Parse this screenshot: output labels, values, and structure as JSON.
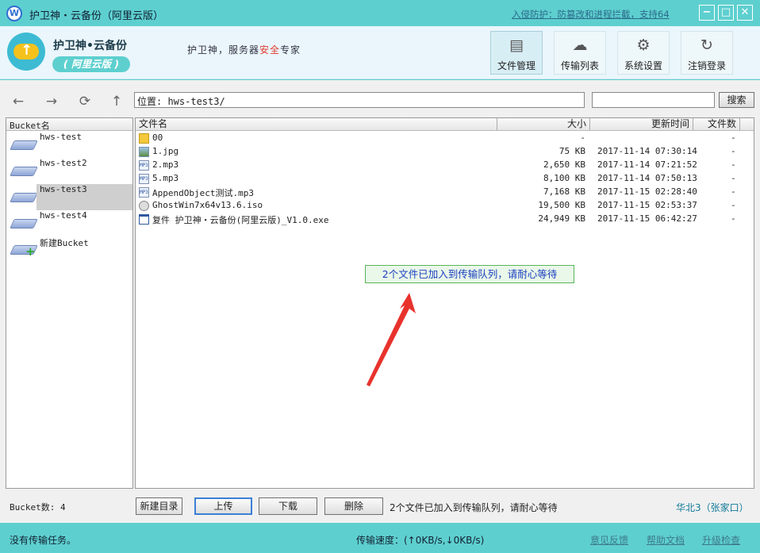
{
  "window": {
    "title": "护卫神・云备份（阿里云版）",
    "notice_link": "入侵防护：防篡改和进程拦截，支持64",
    "btn_min": "−",
    "btn_max": "□",
    "btn_close": "✕",
    "icon_letter": "W"
  },
  "header": {
    "app_name": "护卫神•云备份",
    "app_edition": "( 阿里云版 )",
    "slogan_pre": "护卫神，服务器",
    "slogan_red": "安全",
    "slogan_post": "专家",
    "nav": [
      {
        "label": "文件管理",
        "icon": "file-icon",
        "glyph": "▤"
      },
      {
        "label": "传输列表",
        "icon": "cloud-upload-icon",
        "glyph": "☁"
      },
      {
        "label": "系统设置",
        "icon": "gear-icon",
        "glyph": "⚙"
      },
      {
        "label": "注销登录",
        "icon": "logout-icon",
        "glyph": "↻"
      }
    ]
  },
  "toolbar": {
    "back": "←",
    "forward": "→",
    "refresh": "⟳",
    "up": "↑",
    "path_value": "位置: hws-test3/",
    "search_value": "",
    "search_label": "搜索"
  },
  "buckets": {
    "header": "Bucket名",
    "items": [
      {
        "name": "hws-test",
        "selected": false
      },
      {
        "name": "hws-test2",
        "selected": false
      },
      {
        "name": "hws-test3",
        "selected": true
      },
      {
        "name": "hws-test4",
        "selected": false
      },
      {
        "name": "新建Bucket",
        "selected": false,
        "is_new": true
      }
    ],
    "count_label": "Bucket数: 4"
  },
  "files": {
    "columns": [
      "文件名",
      "大小",
      "更新时间",
      "文件数"
    ],
    "rows": [
      {
        "name": "00",
        "size": "-",
        "time": "",
        "count": "-",
        "type": "folder",
        "badge": ""
      },
      {
        "name": "1.jpg",
        "size": "75 KB",
        "time": "2017-11-14 07:30:14",
        "count": "-",
        "type": "img",
        "badge": ""
      },
      {
        "name": "2.mp3",
        "size": "2,650 KB",
        "time": "2017-11-14 07:21:52",
        "count": "-",
        "type": "mp3",
        "badge": "MP3"
      },
      {
        "name": "5.mp3",
        "size": "8,100 KB",
        "time": "2017-11-14 07:50:13",
        "count": "-",
        "type": "mp3",
        "badge": "MP3"
      },
      {
        "name": "AppendObject测试.mp3",
        "size": "7,168 KB",
        "time": "2017-11-15 02:28:40",
        "count": "-",
        "type": "mp3",
        "badge": "MP3"
      },
      {
        "name": "GhostWin7x64v13.6.iso",
        "size": "19,500 KB",
        "time": "2017-11-15 02:53:37",
        "count": "-",
        "type": "iso",
        "badge": ""
      },
      {
        "name": "复件 护卫神・云备份(阿里云版)_V1.0.exe",
        "size": "24,949 KB",
        "time": "2017-11-15 06:42:27",
        "count": "-",
        "type": "exe",
        "badge": ""
      }
    ]
  },
  "tooltip": "2个文件已加入到传输队列，请耐心等待",
  "actions": {
    "new_dir": "新建目录",
    "upload": "上传",
    "download": "下载",
    "delete": "删除",
    "status": "2个文件已加入到传输队列，请耐心等待",
    "region": "华北3（张家口）"
  },
  "statusbar": {
    "tasks": "没有传输任务。",
    "speed": "传输速度：(↑0KB/s,↓0KB/s)",
    "links": [
      "意见反馈",
      "帮助文档",
      "升级检查"
    ]
  }
}
